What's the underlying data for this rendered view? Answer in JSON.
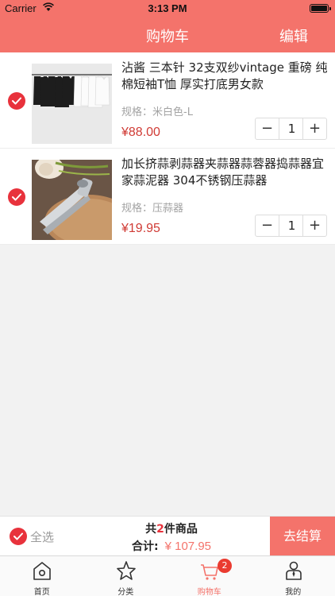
{
  "status_bar": {
    "carrier": "Carrier",
    "time": "3:13 PM"
  },
  "nav": {
    "title": "购物车",
    "edit_label": "编辑"
  },
  "items": [
    {
      "name": "沾酱 三本针 32支双纱vintage 重磅 纯棉短袖T恤 厚实打底男女款",
      "spec_label": "规格：",
      "spec_value": "米白色-L",
      "price": "¥88.00",
      "quantity": "1",
      "minus": "−",
      "plus": "+",
      "checked": true,
      "image": "tshirts-on-rack"
    },
    {
      "name": "加长挤蒜剥蒜器夹蒜器蒜蓉器捣蒜器宜家蒜泥器 304不锈钢压蒜器",
      "spec_label": "规格：",
      "spec_value": "压蒜器",
      "price": "¥19.95",
      "quantity": "1",
      "minus": "−",
      "plus": "+",
      "checked": true,
      "image": "garlic-press"
    }
  ],
  "checkout": {
    "select_all_label": "全选",
    "count_prefix": "共",
    "count": "2",
    "count_suffix": "件商品",
    "total_label": "合计:",
    "total_value": "¥ 107.95",
    "pay_label": "去结算"
  },
  "tabs": [
    {
      "label": "首页",
      "icon": "home-icon",
      "active": false
    },
    {
      "label": "分类",
      "icon": "star-icon",
      "active": false
    },
    {
      "label": "购物车",
      "icon": "cart-icon",
      "active": true,
      "badge": "2"
    },
    {
      "label": "我的",
      "icon": "profile-icon",
      "active": false
    }
  ],
  "colors": {
    "accent": "#f4736b",
    "check_red": "#e8323c",
    "price_red": "#d03b35"
  }
}
